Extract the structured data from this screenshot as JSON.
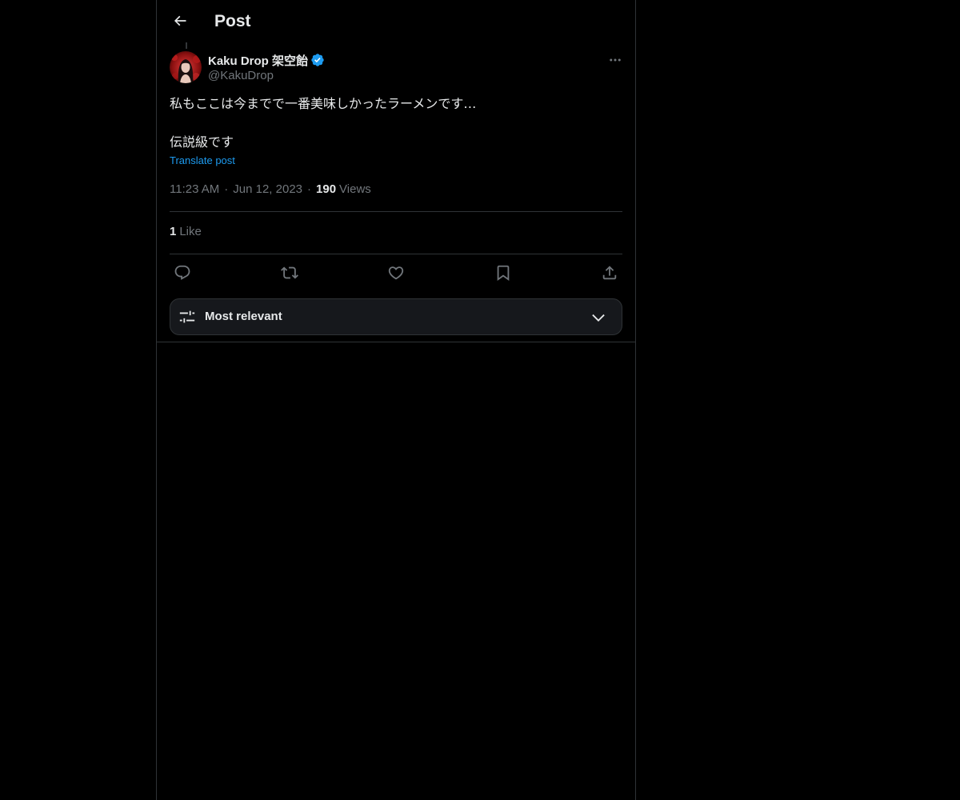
{
  "header": {
    "title": "Post",
    "back_icon": "arrow-left-icon"
  },
  "author": {
    "display_name": "Kaku Drop 架空飴",
    "handle": "@KakuDrop",
    "verified": true,
    "verified_color": "#1d9bf0"
  },
  "post": {
    "lines": [
      "私もここは今までで一番美味しかったラーメンです…",
      "伝説級です"
    ],
    "translate_label": "Translate post",
    "time": "11:23 AM",
    "date": "Jun 12, 2023",
    "views_count": "190",
    "views_label": "Views"
  },
  "engagement": {
    "likes_count": "1",
    "likes_label": "Like"
  },
  "actions": [
    {
      "icon": "reply-icon"
    },
    {
      "icon": "repost-icon"
    },
    {
      "icon": "like-icon"
    },
    {
      "icon": "bookmark-icon"
    },
    {
      "icon": "share-icon"
    }
  ],
  "sort": {
    "label": "Most relevant",
    "icon": "sliders-icon"
  },
  "colors": {
    "background": "#000000",
    "text": "#e7e9ea",
    "muted": "#71767b",
    "accent": "#1d9bf0",
    "border": "#2f3336"
  }
}
